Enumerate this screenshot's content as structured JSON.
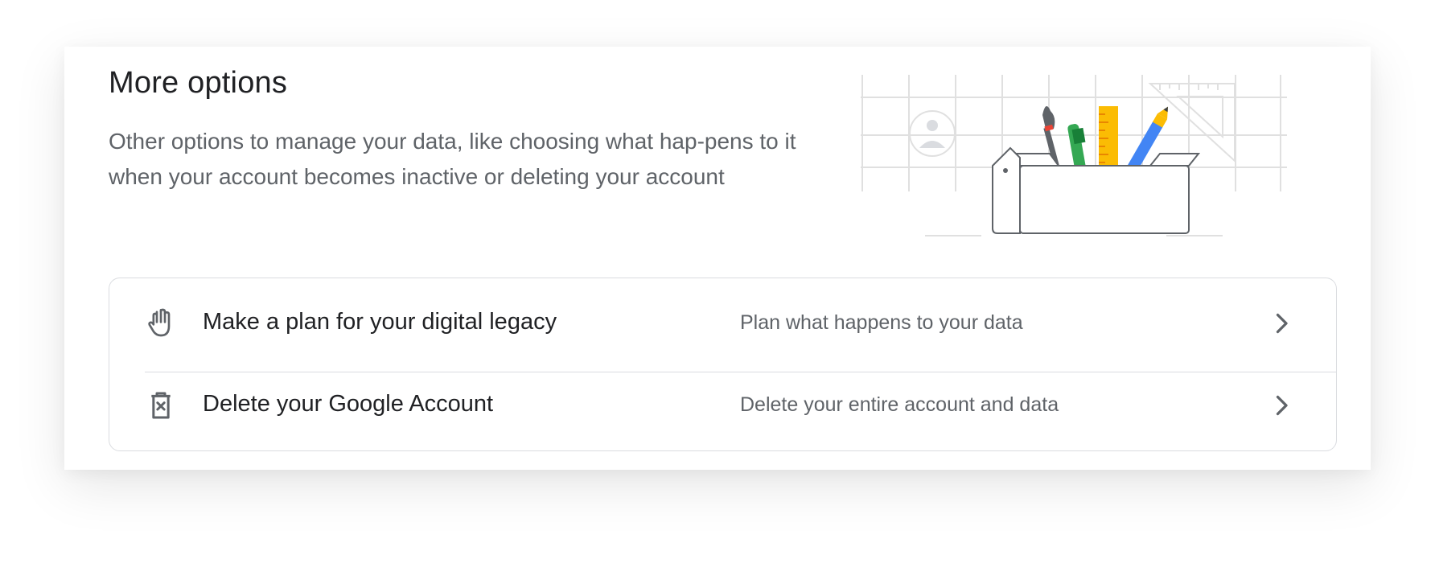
{
  "section": {
    "title": "More options",
    "description": "Other options to manage your data, like choosing what hap-pens to it when your account becomes inactive or deleting your account"
  },
  "options": [
    {
      "icon": "hand-icon",
      "title": "Make a plan for your digital legacy",
      "subtitle": "Plan what happens to your data"
    },
    {
      "icon": "delete-bin-icon",
      "title": "Delete your Google Account",
      "subtitle": "Delete your entire account and data"
    }
  ],
  "colors": {
    "text_primary": "#202124",
    "text_secondary": "#5f6368",
    "border": "#dadce0",
    "icon": "#5f6368",
    "illustration_red": "#ea4335",
    "illustration_green": "#34a853",
    "illustration_yellow": "#fbbc04",
    "illustration_blue": "#4285f4"
  }
}
